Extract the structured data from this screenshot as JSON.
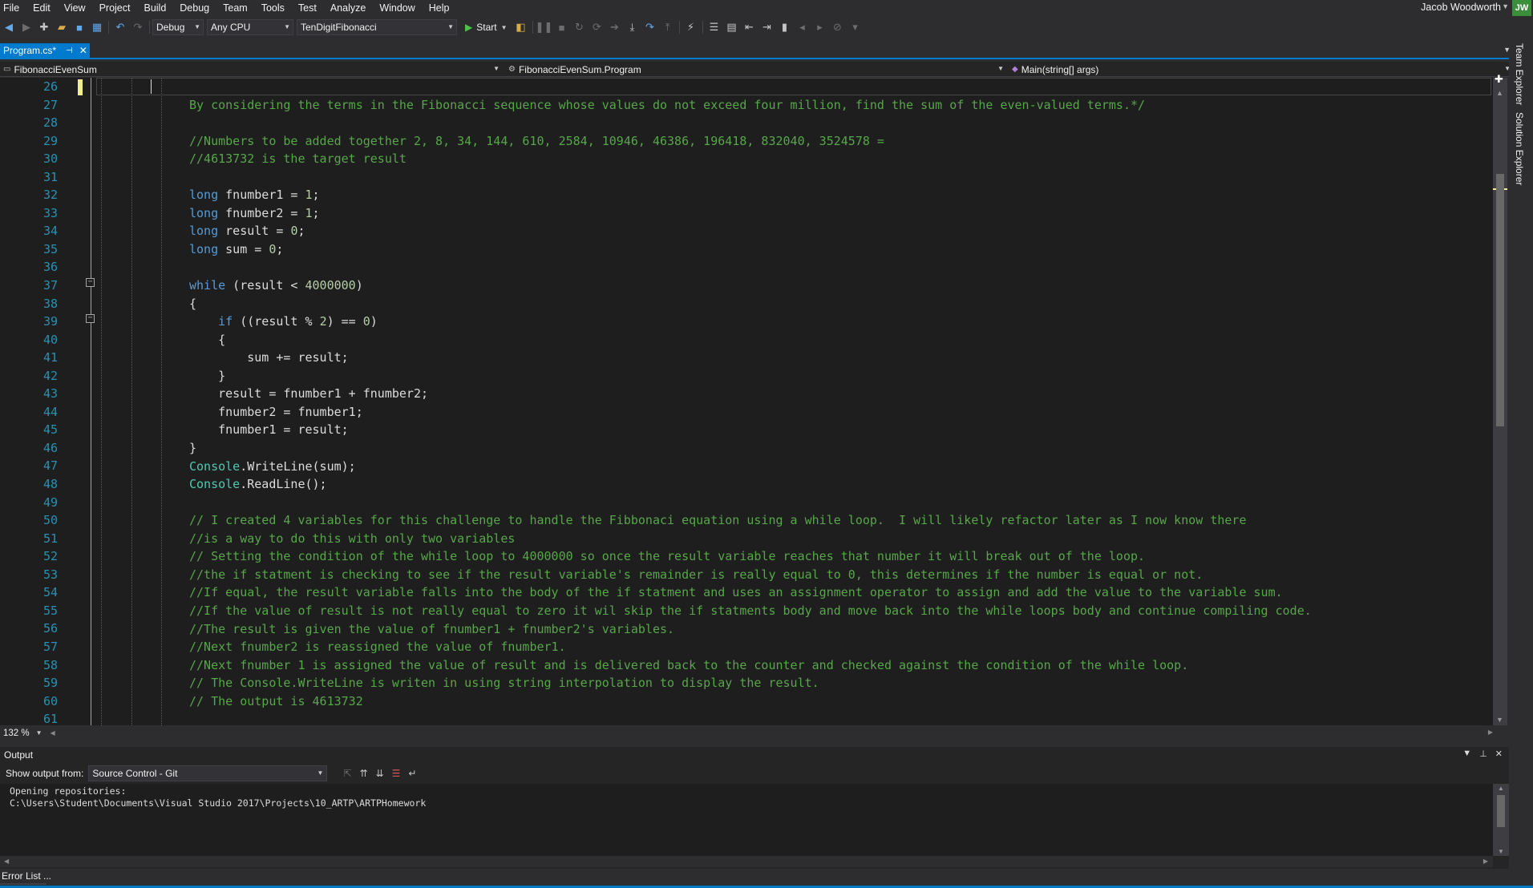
{
  "menu": [
    "File",
    "Edit",
    "View",
    "Project",
    "Build",
    "Debug",
    "Team",
    "Tools",
    "Test",
    "Analyze",
    "Window",
    "Help"
  ],
  "user": {
    "name": "Jacob Woodworth",
    "initials": "JW"
  },
  "toolbar": {
    "configuration": "Debug",
    "platform": "Any CPU",
    "startup_project": "TenDigitFibonacci",
    "start_label": "Start"
  },
  "document_tab": {
    "label": "Program.cs*"
  },
  "navigation": {
    "project": "FibonacciEvenSum",
    "type": "FibonacciEvenSum.Program",
    "member": "Main(string[] args)"
  },
  "editor": {
    "line_numbers": [
      "26",
      "27",
      "28",
      "29",
      "30",
      "31",
      "32",
      "33",
      "34",
      "35",
      "36",
      "37",
      "38",
      "39",
      "40",
      "41",
      "42",
      "43",
      "44",
      "45",
      "46",
      "47",
      "48",
      "49",
      "50",
      "51",
      "52",
      "53",
      "54",
      "55",
      "56",
      "57",
      "58",
      "59",
      "60",
      "61"
    ],
    "zoom": "132 %",
    "lines": [
      [],
      [
        {
          "t": "        By considering the terms in the Fibonacci sequence whose values do not exceed four million, find the sum of the even-valued terms.*/",
          "c": "comment"
        }
      ],
      [],
      [
        {
          "t": "        //Numbers to be added together 2, 8, 34, 144, 610, 2584, 10946, 46386, 196418, 832040, 3524578 =",
          "c": "comment"
        }
      ],
      [
        {
          "t": "        //4613732 is the target result",
          "c": "comment"
        }
      ],
      [],
      [
        {
          "t": "        ",
          "c": "plain"
        },
        {
          "t": "long",
          "c": "keyword"
        },
        {
          "t": " fnumber1 = ",
          "c": "plain"
        },
        {
          "t": "1",
          "c": "number"
        },
        {
          "t": ";",
          "c": "plain"
        }
      ],
      [
        {
          "t": "        ",
          "c": "plain"
        },
        {
          "t": "long",
          "c": "keyword"
        },
        {
          "t": " fnumber2 = ",
          "c": "plain"
        },
        {
          "t": "1",
          "c": "number"
        },
        {
          "t": ";",
          "c": "plain"
        }
      ],
      [
        {
          "t": "        ",
          "c": "plain"
        },
        {
          "t": "long",
          "c": "keyword"
        },
        {
          "t": " result = ",
          "c": "plain"
        },
        {
          "t": "0",
          "c": "number"
        },
        {
          "t": ";",
          "c": "plain"
        }
      ],
      [
        {
          "t": "        ",
          "c": "plain"
        },
        {
          "t": "long",
          "c": "keyword"
        },
        {
          "t": " sum = ",
          "c": "plain"
        },
        {
          "t": "0",
          "c": "number"
        },
        {
          "t": ";",
          "c": "plain"
        }
      ],
      [],
      [
        {
          "t": "        ",
          "c": "plain"
        },
        {
          "t": "while",
          "c": "keyword"
        },
        {
          "t": " (result < ",
          "c": "plain"
        },
        {
          "t": "4000000",
          "c": "number"
        },
        {
          "t": ")",
          "c": "plain"
        }
      ],
      [
        {
          "t": "        {",
          "c": "plain"
        }
      ],
      [
        {
          "t": "            ",
          "c": "plain"
        },
        {
          "t": "if",
          "c": "keyword"
        },
        {
          "t": " ((result % ",
          "c": "plain"
        },
        {
          "t": "2",
          "c": "number"
        },
        {
          "t": ") == ",
          "c": "plain"
        },
        {
          "t": "0",
          "c": "number"
        },
        {
          "t": ")",
          "c": "plain"
        }
      ],
      [
        {
          "t": "            {",
          "c": "plain"
        }
      ],
      [
        {
          "t": "                sum += result;",
          "c": "plain"
        }
      ],
      [
        {
          "t": "            }",
          "c": "plain"
        }
      ],
      [
        {
          "t": "            result = fnumber1 + fnumber2;",
          "c": "plain"
        }
      ],
      [
        {
          "t": "            fnumber2 = fnumber1;",
          "c": "plain"
        }
      ],
      [
        {
          "t": "            fnumber1 = result;",
          "c": "plain"
        }
      ],
      [
        {
          "t": "        }",
          "c": "plain"
        }
      ],
      [
        {
          "t": "        ",
          "c": "plain"
        },
        {
          "t": "Console",
          "c": "type"
        },
        {
          "t": ".WriteLine(sum);",
          "c": "plain"
        }
      ],
      [
        {
          "t": "        ",
          "c": "plain"
        },
        {
          "t": "Console",
          "c": "type"
        },
        {
          "t": ".ReadLine();",
          "c": "plain"
        }
      ],
      [],
      [
        {
          "t": "        // I created 4 variables for this challenge to handle the Fibbonaci equation using a while loop.  I will likely refactor later as I now know there",
          "c": "comment"
        }
      ],
      [
        {
          "t": "        //is a way to do this with only two variables",
          "c": "comment"
        }
      ],
      [
        {
          "t": "        // Setting the condition of the while loop to 4000000 so once the result variable reaches that number it will break out of the loop.",
          "c": "comment"
        }
      ],
      [
        {
          "t": "        //the if statment is checking to see if the result variable's remainder is really equal to 0, this determines if the number is equal or not.",
          "c": "comment"
        }
      ],
      [
        {
          "t": "        //If equal, the result variable falls into the body of the if statment and uses an assignment operator to assign and add the value to the variable sum.",
          "c": "comment"
        }
      ],
      [
        {
          "t": "        //If the value of result is not really equal to zero it wil skip the if statments body and move back into the while loops body and continue compiling code.",
          "c": "comment"
        }
      ],
      [
        {
          "t": "        //The result is given the value of fnumber1 + fnumber2's variables.",
          "c": "comment"
        }
      ],
      [
        {
          "t": "        //Next fnumber2 is reassigned the value of fnumber1.",
          "c": "comment"
        }
      ],
      [
        {
          "t": "        //Next fnumber 1 is assigned the value of result and is delivered back to the counter and checked against the condition of the while loop.",
          "c": "comment"
        }
      ],
      [
        {
          "t": "        // The Console.WriteLine is writen in using string interpolation to display the result.",
          "c": "comment"
        }
      ],
      [
        {
          "t": "        // The output is 4613732",
          "c": "comment"
        }
      ],
      []
    ]
  },
  "side_tabs": [
    "Team Explorer",
    "Solution Explorer"
  ],
  "output": {
    "title": "Output",
    "show_from_label": "Show output from:",
    "source": "Source Control - Git",
    "text": "Opening repositories:\nC:\\Users\\Student\\Documents\\Visual Studio 2017\\Projects\\10_ARTP\\ARTPHomework"
  },
  "bottom_tab": "Error List ..."
}
